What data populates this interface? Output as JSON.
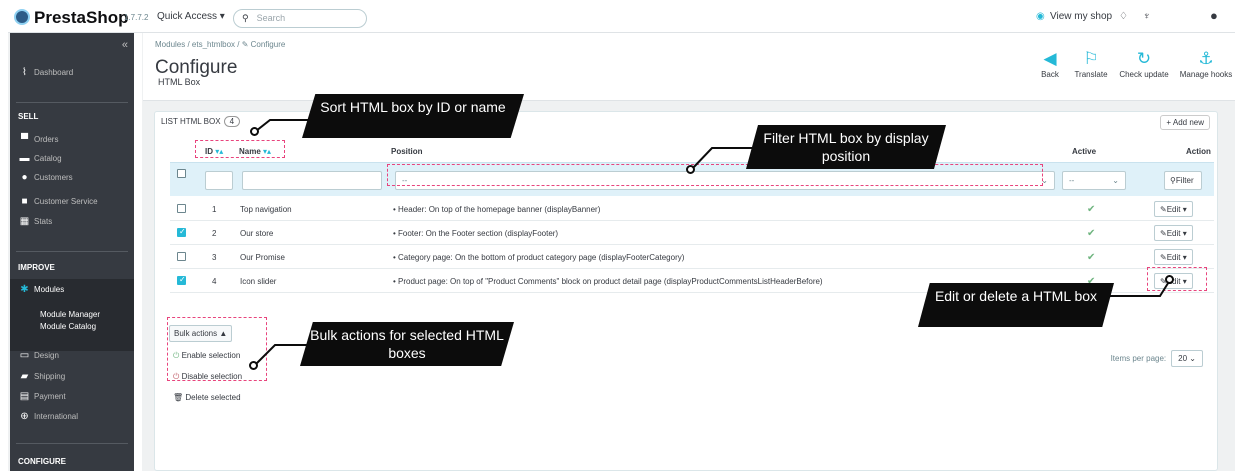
{
  "topbar": {
    "brand": "PrestaShop",
    "version": "1.7.7.2",
    "quick_access": "Quick Access ▾",
    "search_placeholder": "Search",
    "view_shop": "View my shop"
  },
  "sidebar": {
    "dashboard": "Dashboard",
    "sell": "SELL",
    "orders": "Orders",
    "catalog": "Catalog",
    "customers": "Customers",
    "customer_service": "Customer Service",
    "stats": "Stats",
    "improve": "IMPROVE",
    "modules": "Modules",
    "module_manager": "Module Manager",
    "module_catalog": "Module Catalog",
    "design": "Design",
    "shipping": "Shipping",
    "payment": "Payment",
    "international": "International",
    "configure": "CONFIGURE"
  },
  "header": {
    "breadcrumb": "Modules  /  ets_htmlbox  /  ✎ Configure",
    "title": "Configure",
    "subtitle": "HTML Box",
    "toolbar": {
      "back": "Back",
      "translate": "Translate",
      "check_update": "Check update",
      "manage_hooks": "Manage hooks"
    }
  },
  "panel": {
    "title": "LIST HTML BOX",
    "count": "4",
    "add_new": "+ Add new",
    "columns": {
      "id": "ID",
      "name": "Name",
      "position": "Position",
      "active": "Active",
      "action": "Action"
    },
    "filter_position": "--",
    "filter_active": "--",
    "filter_btn": "Filter",
    "rows": [
      {
        "id": "1",
        "name": "Top navigation",
        "position": "• Header: On top of the homepage banner (displayBanner)",
        "checked": false
      },
      {
        "id": "2",
        "name": "Our store",
        "position": "• Footer: On the Footer section (displayFooter)",
        "checked": true
      },
      {
        "id": "3",
        "name": "Our Promise",
        "position": "• Category page: On the bottom of product category page (displayFooterCategory)",
        "checked": false
      },
      {
        "id": "4",
        "name": "Icon slider",
        "position": "• Product page: On top of \"Product Comments\" block on product detail page (displayProductCommentsListHeaderBefore)",
        "checked": true
      }
    ],
    "edit": "Edit",
    "bulk_actions": "Bulk actions ▲",
    "bulk": {
      "enable": "Enable selection",
      "disable": "Disable selection",
      "delete": "Delete selected"
    },
    "items_per_page": "Items per page:",
    "ipp_value": "20"
  },
  "callouts": {
    "sort": "Sort HTML box by ID or name",
    "filter": "Filter HTML box by display position",
    "edit": "Edit or delete a HTML box",
    "bulk": "Bulk actions for selected HTML boxes"
  }
}
